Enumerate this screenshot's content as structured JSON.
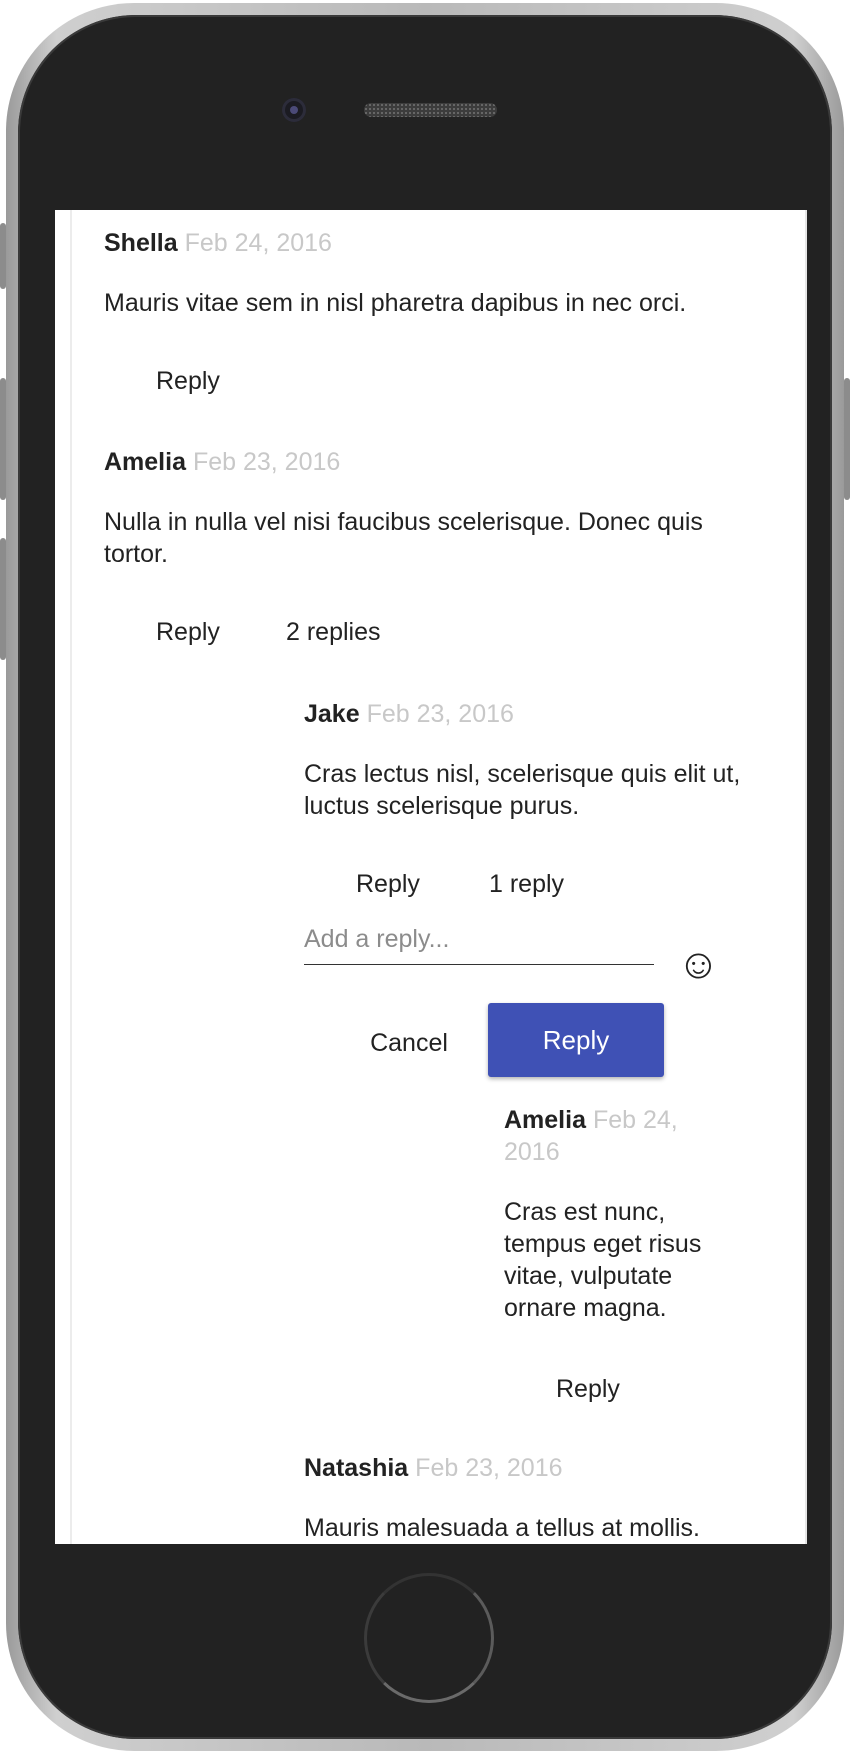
{
  "comments": [
    {
      "author": "Shella",
      "date": "Feb 24, 2016",
      "text": "Mauris vitae sem in nisl pharetra dapibus in nec orci.",
      "reply_label": "Reply"
    },
    {
      "author": "Amelia",
      "date": "Feb 23, 2016",
      "text": "Nulla in nulla vel nisi faucibus scelerisque. Donec quis tortor.",
      "reply_label": "Reply",
      "replies_label": "2 replies"
    },
    {
      "author": "Jake",
      "date": "Feb 23, 2016",
      "text": "Cras lectus nisl, scelerisque quis elit ut, luctus scelerisque purus.",
      "reply_label": "Reply",
      "replies_label": "1 reply"
    },
    {
      "author": "Amelia",
      "date": "Feb 24, 2016",
      "text": "Cras est nunc, tempus eget risus vitae, vulputate ornare magna.",
      "reply_label": "Reply"
    },
    {
      "author": "Natashia",
      "date": "Feb 23, 2016",
      "text": "Mauris malesuada a tellus at mollis."
    }
  ],
  "reply_form": {
    "placeholder": "Add a reply...",
    "emoji_icon": "☺",
    "cancel_label": "Cancel",
    "submit_label": "Reply"
  },
  "colors": {
    "accent": "#3f51b5",
    "date": "#c8c8c8",
    "phone_body": "#222222"
  }
}
